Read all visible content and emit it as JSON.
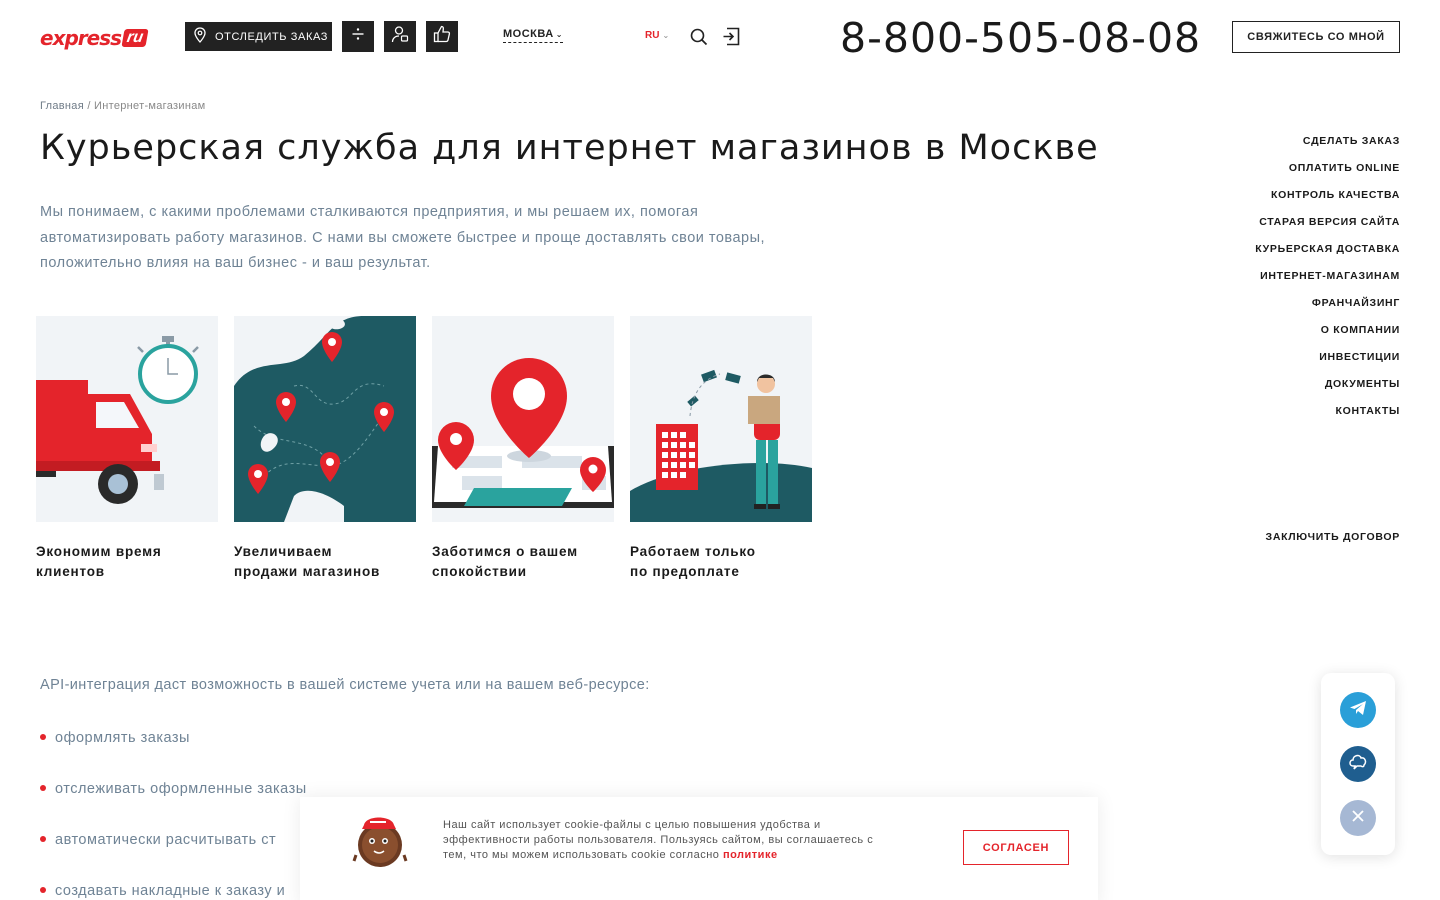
{
  "header": {
    "logo_text": "express",
    "logo_suffix": "ru",
    "track_label": "ОТСЛЕДИТЬ ЗАКАЗ",
    "city": "МОСКВА",
    "lang": "RU",
    "phone": "8-800-505-08-08",
    "contact_label": "СВЯЖИТЕСЬ СО МНОЙ"
  },
  "breadcrumb": {
    "home": "Главная",
    "separator": " / ",
    "current": "Интернет-магазинам"
  },
  "page_title": "Курьерская служба для интернет магазинов в Москве",
  "intro": "Мы понимаем, с какими проблемами сталкиваются предприятия, и мы решаем их, помогая автоматизировать работу магазинов. С нами вы сможете быстрее и проще доставлять свои товары, положительно влияя на ваш бизнес - и ваш результат.",
  "cards": [
    {
      "line1": "Экономим время",
      "line2": "клиентов"
    },
    {
      "line1": "Увеличиваем",
      "line2": "продажи магазинов"
    },
    {
      "line1": "Заботимся о вашем",
      "line2": "спокойствии"
    },
    {
      "line1": "Работаем только",
      "line2": "по предоплате"
    }
  ],
  "right_nav": [
    "СДЕЛАТЬ ЗАКАЗ",
    "ОПЛАТИТЬ ONLINE",
    "КОНТРОЛЬ КАЧЕСТВА",
    "СТАРАЯ ВЕРСИЯ САЙТА",
    "КУРЬЕРСКАЯ ДОСТАВКА",
    "ИНТЕРНЕТ-МАГАЗИНАМ",
    "ФРАНЧАЙЗИНГ",
    "О КОМПАНИИ",
    "ИНВЕСТИЦИИ",
    "ДОКУМЕНТЫ",
    "КОНТАКТЫ"
  ],
  "contract_link": "ЗАКЛЮЧИТЬ ДОГОВОР",
  "api": {
    "intro": "API-интеграция даст возможность в вашей системе учета или на вашем веб-ресурсе:",
    "items": [
      "оформлять заказы",
      "отслеживать оформленные заказы",
      "автоматически расчитывать ст",
      "создавать накладные к заказу и"
    ]
  },
  "cookie": {
    "text": "Наш сайт использует cookie-файлы с целью повышения удобства и эффективности работы пользователя. Пользуясь сайтом, вы соглашаетесь с тем, что мы можем использовать cookie согласно",
    "policy": "политике",
    "accept": "СОГЛАСЕН"
  },
  "colors": {
    "brand_red": "#e4242b",
    "dark": "#222222",
    "muted_text": "#6f8395",
    "map_teal": "#1e5a63",
    "accent_teal": "#2aa39e"
  },
  "icons": {
    "track": "location-pin-icon",
    "calc": "calculator-icon",
    "account": "user-icon",
    "feedback": "thumbs-up-icon",
    "search": "search-icon",
    "login": "login-icon",
    "telegram": "telegram-icon",
    "chat": "chat-cloud-icon",
    "close": "close-icon"
  }
}
